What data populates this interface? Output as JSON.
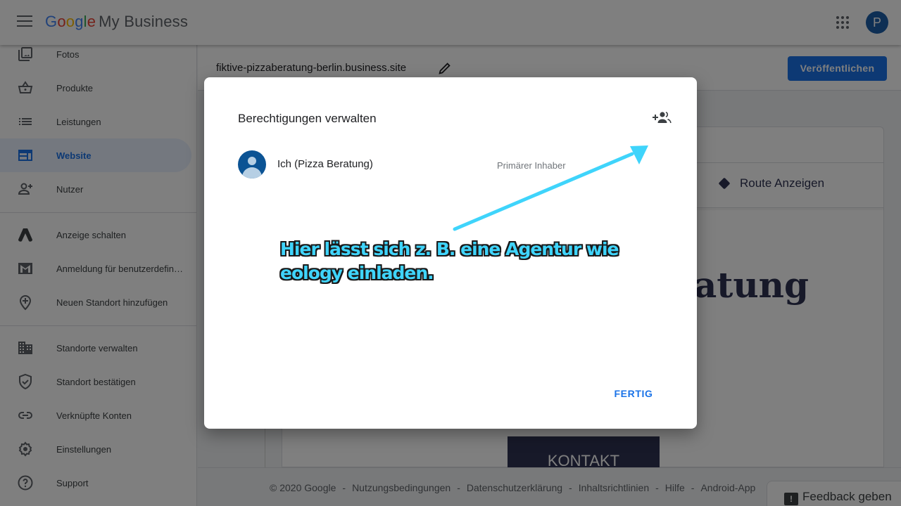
{
  "header": {
    "logo_letters": [
      "G",
      "o",
      "o",
      "g",
      "l",
      "e"
    ],
    "product_name": "My Business",
    "avatar_initial": "P"
  },
  "sidebar": {
    "items": [
      {
        "label": "Fotos",
        "icon": "photos-icon",
        "active": false
      },
      {
        "label": "Produkte",
        "icon": "basket-icon",
        "active": false
      },
      {
        "label": "Leistungen",
        "icon": "list-icon",
        "active": false
      },
      {
        "label": "Website",
        "icon": "website-icon",
        "active": true
      },
      {
        "label": "Nutzer",
        "icon": "add-person-icon",
        "active": false
      },
      {
        "label": "Anzeige schalten",
        "icon": "google-ads-icon",
        "active": false
      },
      {
        "label": "Anmeldung für benutzerdefini…",
        "icon": "gmail-icon",
        "active": false
      },
      {
        "label": "Neuen Standort hinzufügen",
        "icon": "add-location-icon",
        "active": false
      },
      {
        "label": "Standorte verwalten",
        "icon": "building-icon",
        "active": false
      },
      {
        "label": "Standort bestätigen",
        "icon": "verified-shield-icon",
        "active": false
      },
      {
        "label": "Verknüpfte Konten",
        "icon": "link-icon",
        "active": false
      },
      {
        "label": "Einstellungen",
        "icon": "gear-icon",
        "active": false
      },
      {
        "label": "Support",
        "icon": "help-icon",
        "active": false
      }
    ]
  },
  "main": {
    "site_url": "fiktive-pizzaberatung-berlin.business.site",
    "publish_label": "Veröffentlichen",
    "route_label": "Route Anzeigen",
    "hero_text_fragment": "atung",
    "contact_label": "KONTAKT"
  },
  "footer": {
    "copyright": "© 2020 Google",
    "links": [
      "Nutzungsbedingungen",
      "Datenschutzerklärung",
      "Inhaltsrichtlinien",
      "Hilfe",
      "Android-App"
    ],
    "feedback_label": "Feedback geben"
  },
  "dialog": {
    "title": "Berechtigungen verwalten",
    "users": [
      {
        "name": "Ich (Pizza Beratung)",
        "role": "Primärer Inhaber"
      }
    ],
    "done_label": "FERTIG"
  },
  "annotation": {
    "line1": "Hier lässt sich z. B. eine Agentur wie",
    "line2": "eology einladen.",
    "color": "#3fd4fb"
  }
}
